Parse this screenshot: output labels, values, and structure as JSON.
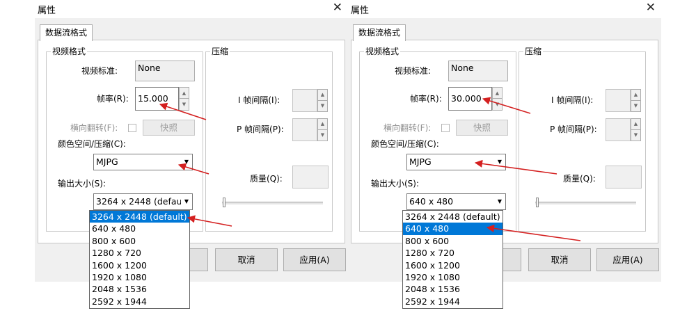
{
  "dialogs": [
    {
      "title": "属性",
      "close_glyph": "✕",
      "tab": "数据流格式",
      "video_group": "视频格式",
      "compress_group": "压缩",
      "video_standard_label": "视频标准:",
      "video_standard_value": "None",
      "frame_rate_label": "帧率(R):",
      "frame_rate_value": "15.000",
      "flip_label": "横向翻转(F):",
      "snapshot_button": "快照",
      "color_space_label": "颜色空间/压缩(C):",
      "color_space_value": "MJPG",
      "output_size_label": "输出大小(S):",
      "output_size_value": "3264 x 2448  (defau",
      "i_frame_label": "I 帧间隔(I):",
      "p_frame_label": "P 帧间隔(P):",
      "quality_label": "质量(Q):",
      "cancel_button": "取消",
      "apply_button": "应用(A)",
      "dropdown_options": [
        "3264 x 2448  (default)",
        "640 x 480",
        "800 x 600",
        "1280 x 720",
        "1600 x 1200",
        "1920 x 1080",
        "2048 x 1536",
        "2592 x 1944"
      ],
      "dropdown_selected_index": 0
    },
    {
      "title": "属性",
      "close_glyph": "✕",
      "tab": "数据流格式",
      "video_group": "视频格式",
      "compress_group": "压缩",
      "video_standard_label": "视频标准:",
      "video_standard_value": "None",
      "frame_rate_label": "帧率(R):",
      "frame_rate_value": "30.000",
      "flip_label": "横向翻转(F):",
      "snapshot_button": "快照",
      "color_space_label": "颜色空间/压缩(C):",
      "color_space_value": "MJPG",
      "output_size_label": "输出大小(S):",
      "output_size_value": "640 x 480",
      "i_frame_label": "I 帧间隔(I):",
      "p_frame_label": "P 帧间隔(P):",
      "quality_label": "质量(Q):",
      "cancel_button": "取消",
      "apply_button": "应用(A)",
      "dropdown_options": [
        "3264 x 2448  (default)",
        "640 x 480",
        "800 x 600",
        "1280 x 720",
        "1600 x 1200",
        "1920 x 1080",
        "2048 x 1536",
        "2592 x 1944"
      ],
      "dropdown_selected_index": 1
    }
  ],
  "colors": {
    "annotation_arrow": "#d42020",
    "selection": "#0078d7"
  },
  "icons": {
    "close": "close-icon",
    "spin_up": "chevron-up-icon",
    "spin_down": "chevron-down-icon",
    "combo_arrow": "dropdown-arrow-icon"
  }
}
